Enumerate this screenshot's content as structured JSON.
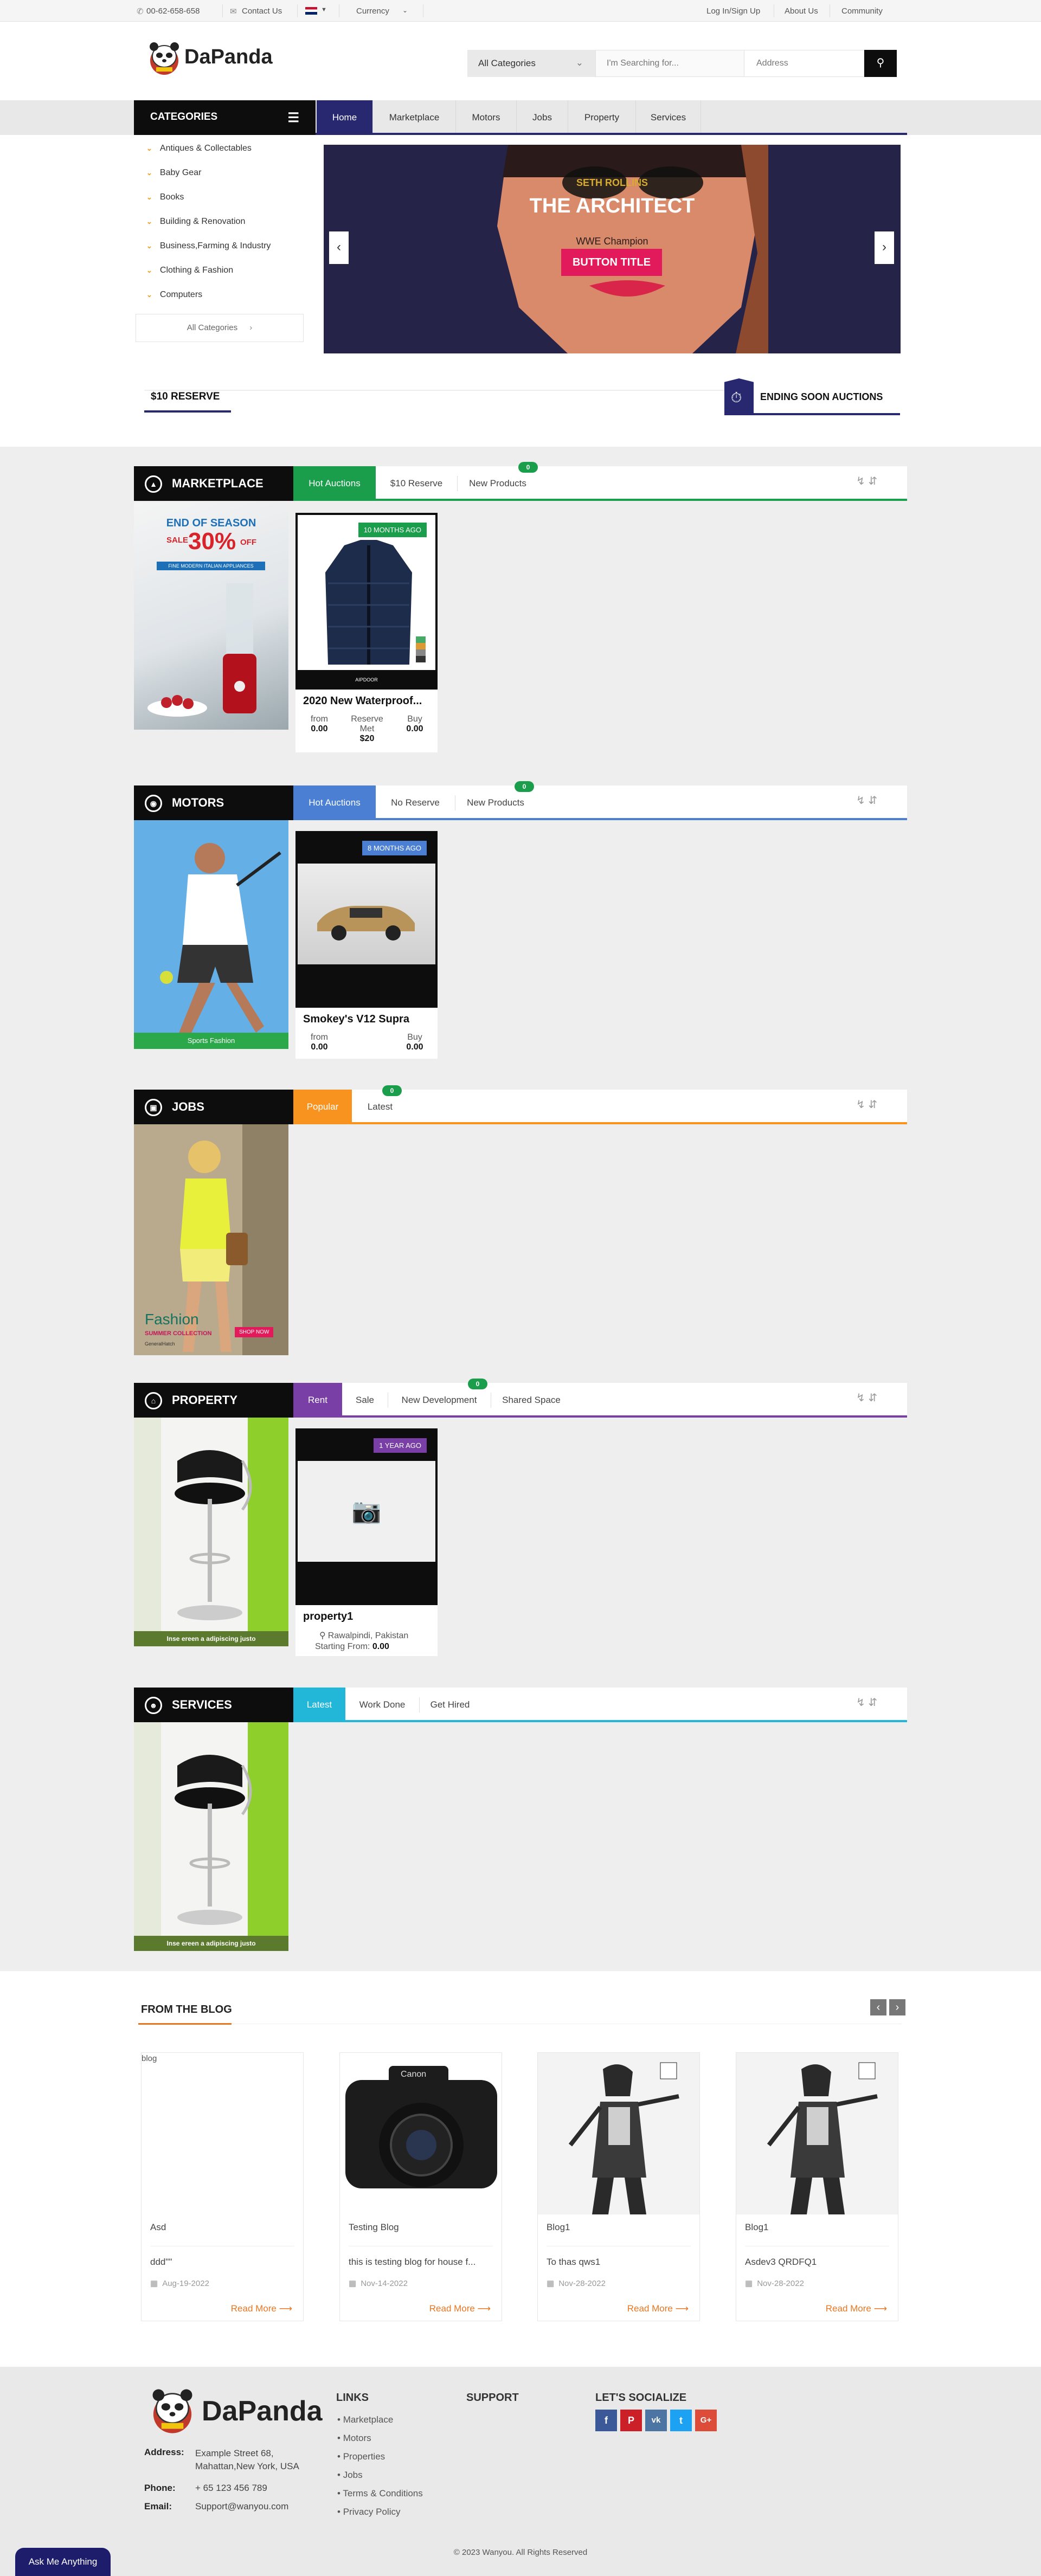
{
  "topbar": {
    "phone": "00-62-658-658",
    "contact": "Contact Us",
    "currency": "Currency",
    "login": "Log In/Sign Up",
    "about": "About Us",
    "community": "Community"
  },
  "header": {
    "logo_text": "DaPanda",
    "category_select": "All Categories",
    "search_placeholder": "I'm Searching for...",
    "address_placeholder": "Address"
  },
  "nav": {
    "categories_label": "CATEGORIES",
    "links": [
      "Home",
      "Marketplace",
      "Motors",
      "Jobs",
      "Property",
      "Services"
    ]
  },
  "sidebar": {
    "items": [
      "Antiques & Collectables",
      "Baby Gear",
      "Books",
      "Building & Renovation",
      "Business,Farming & Industry",
      "Clothing & Fashion",
      "Computers"
    ],
    "all_label": "All Categories"
  },
  "slider": {
    "kicker": "SETH ROLLINS",
    "title": "THE ARCHITECT",
    "subtitle": "WWE Champion",
    "button": "BUTTON TITLE"
  },
  "reserve_tabs": {
    "left": "$10 RESERVE",
    "right": "ENDING SOON AUCTIONS"
  },
  "sections": {
    "marketplace": {
      "title": "MARKETPLACE",
      "color": "#1a9e4b",
      "tabs": [
        "Hot Auctions",
        "$10 Reserve",
        "New Products"
      ],
      "badge": "0",
      "banner": {
        "l1": "END OF SEASON",
        "l2": "SALE",
        "l3": "30%",
        "l4": "OFF",
        "l5": "FINE MODERN ITALIAN APPLIANCES"
      },
      "card": {
        "tag": "10 MONTHS AGO",
        "title": "2020 New Waterproof...",
        "from_label": "from",
        "from_value": "0.00",
        "reserve_label": "Reserve",
        "reserve_value": "Met",
        "buy_label": "Buy",
        "buy_value": "0.00",
        "price": "$20",
        "brand": "AIPDOOR"
      }
    },
    "motors": {
      "title": "MOTORS",
      "color": "#4a7fd4",
      "tabs": [
        "Hot Auctions",
        "No Reserve",
        "New Products"
      ],
      "badge": "0",
      "banner": {
        "caption": "Sports Fashion"
      },
      "card": {
        "tag": "8 MONTHS AGO",
        "title": "Smokey's V12 Supra",
        "from_label": "from",
        "from_value": "0.00",
        "buy_label": "Buy",
        "buy_value": "0.00"
      }
    },
    "jobs": {
      "title": "JOBS",
      "color": "#f7931e",
      "tabs": [
        "Popular",
        "Latest"
      ],
      "badge": "0",
      "banner": {
        "big": "Fashion",
        "small": "SUMMER COLLECTION",
        "btn": "SHOP NOW",
        "tiny": "GeneralHatch"
      }
    },
    "property": {
      "title": "PROPERTY",
      "color": "#7a3fa6",
      "tabs": [
        "Rent",
        "Sale",
        "New Development",
        "Shared Space"
      ],
      "badge": "0",
      "banner": {
        "caption": "Inse ereen a adipiscing justo"
      },
      "card": {
        "tag": "1 YEAR AGO",
        "title": "property1",
        "location": "Rawalpindi, Pakistan",
        "starting_label": "Starting From:",
        "starting_value": "0.00"
      }
    },
    "services": {
      "title": "SERVICES",
      "color": "#22b7d8",
      "tabs": [
        "Latest",
        "Work Done",
        "Get Hired"
      ],
      "banner": {
        "caption": "Inse ereen a adipiscing justo"
      }
    }
  },
  "blog": {
    "heading": "FROM THE BLOG",
    "posts": [
      {
        "img_alt": "blog",
        "title": "Asd",
        "desc": "ddd\"\"",
        "date": "Aug-19-2022",
        "more": "Read More"
      },
      {
        "img_alt": "",
        "title": "Testing Blog",
        "desc": "this is testing blog for house f...",
        "date": "Nov-14-2022",
        "more": "Read More"
      },
      {
        "img_alt": "",
        "title": "Blog1",
        "desc": "To thas qws1",
        "date": "Nov-28-2022",
        "more": "Read More"
      },
      {
        "img_alt": "",
        "title": "Blog1",
        "desc": "Asdev3 QRDFQ1",
        "date": "Nov-28-2022",
        "more": "Read More"
      }
    ]
  },
  "footer": {
    "logo_text": "DaPanda",
    "address_label": "Address:",
    "address_value": "Example Street 68, Mahattan,New York, USA",
    "phone_label": "Phone:",
    "phone_value": "+ 65 123 456 789",
    "email_label": "Email:",
    "email_value": "Support@wanyou.com",
    "links_heading": "LINKS",
    "links": [
      "Marketplace",
      "Motors",
      "Properties",
      "Jobs",
      "Terms & Conditions",
      "Privacy Policy"
    ],
    "support_heading": "SUPPORT",
    "social_heading": "LET'S SOCIALIZE",
    "social": [
      {
        "name": "facebook-icon",
        "glyph": "f",
        "color": "#3b5998"
      },
      {
        "name": "pinterest-icon",
        "glyph": "P",
        "color": "#cb2027"
      },
      {
        "name": "vk-icon",
        "glyph": "vk",
        "color": "#4c75a3"
      },
      {
        "name": "twitter-icon",
        "glyph": "t",
        "color": "#1da1f2"
      },
      {
        "name": "google-plus-icon",
        "glyph": "G+",
        "color": "#dd4b39"
      }
    ],
    "copyright": "© 2023 Wanyou. All Rights Reserved",
    "chat_button": "Ask Me Anything"
  }
}
